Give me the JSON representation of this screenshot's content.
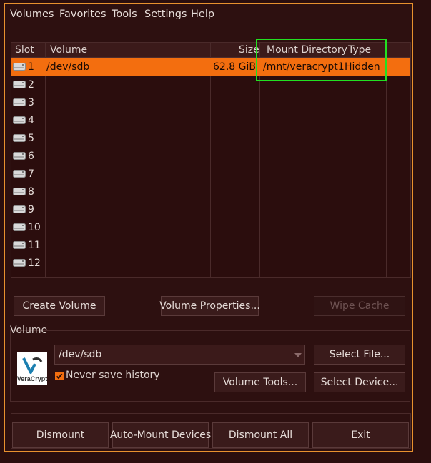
{
  "menu": [
    "Volumes",
    "Favorites",
    "Tools",
    "Settings",
    "Help"
  ],
  "table": {
    "columns": [
      "Slot",
      "Volume",
      "Size",
      "Mount Directory",
      "Type"
    ],
    "rows": [
      {
        "slot": "1",
        "volume": "/dev/sdb",
        "size": "62.8 GiB",
        "mount": "/mnt/veracrypt1",
        "type": "Hidden"
      },
      {
        "slot": "2"
      },
      {
        "slot": "3"
      },
      {
        "slot": "4"
      },
      {
        "slot": "5"
      },
      {
        "slot": "6"
      },
      {
        "slot": "7"
      },
      {
        "slot": "8"
      },
      {
        "slot": "9"
      },
      {
        "slot": "10"
      },
      {
        "slot": "11"
      },
      {
        "slot": "12"
      }
    ]
  },
  "buttons": {
    "create_volume": "Create Volume",
    "volume_properties": "Volume Properties...",
    "wipe_cache": "Wipe Cache",
    "select_file": "Select File...",
    "volume_tools": "Volume Tools...",
    "select_device": "Select Device...",
    "dismount": "Dismount",
    "auto_mount": "Auto-Mount Devices",
    "dismount_all": "Dismount All",
    "exit": "Exit"
  },
  "volume_group": {
    "label": "Volume",
    "path": "/dev/sdb",
    "never_save_history": "Never save history",
    "logo_text": "VeraCrypt"
  },
  "colors": {
    "accent": "#f36e0f",
    "frame": "#e8912e",
    "highlight": "#22e022",
    "background": "#2d1010"
  }
}
